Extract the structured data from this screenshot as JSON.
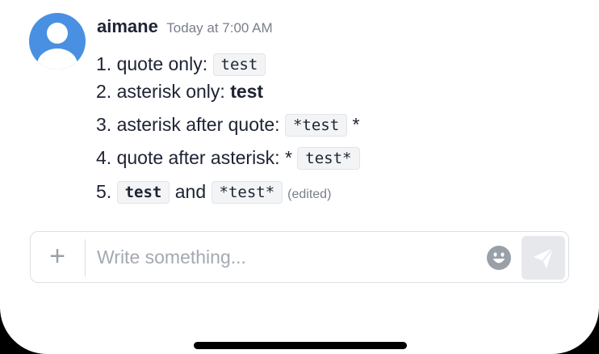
{
  "message": {
    "author": "aimane",
    "timestamp": "Today at 7:00 AM",
    "lines": [
      {
        "prefix": "1. quote only: ",
        "code": "test"
      },
      {
        "prefix": "2. asterisk only: ",
        "bold": "test"
      },
      {
        "prefix": "3. asterisk after quote: ",
        "code": "*test",
        "suffix": " *"
      },
      {
        "prefix": "4. quote after asterisk: * ",
        "code": "test*"
      },
      {
        "prefix": "5. ",
        "code": "test",
        "middle": " and ",
        "code2": "*test*",
        "edited": "(edited)"
      }
    ]
  },
  "composer": {
    "plus_label": "+",
    "placeholder": "Write something..."
  },
  "icons": {
    "avatar": "user-avatar-icon",
    "emoji": "emoji-smile-icon",
    "send": "paper-plane-icon",
    "plus": "plus-icon"
  },
  "colors": {
    "avatar_bg": "#4a90e2",
    "text": "#1d2333",
    "muted": "#7a7f8a",
    "code_bg": "#f3f4f6",
    "send_bg": "#e6e8ec"
  }
}
